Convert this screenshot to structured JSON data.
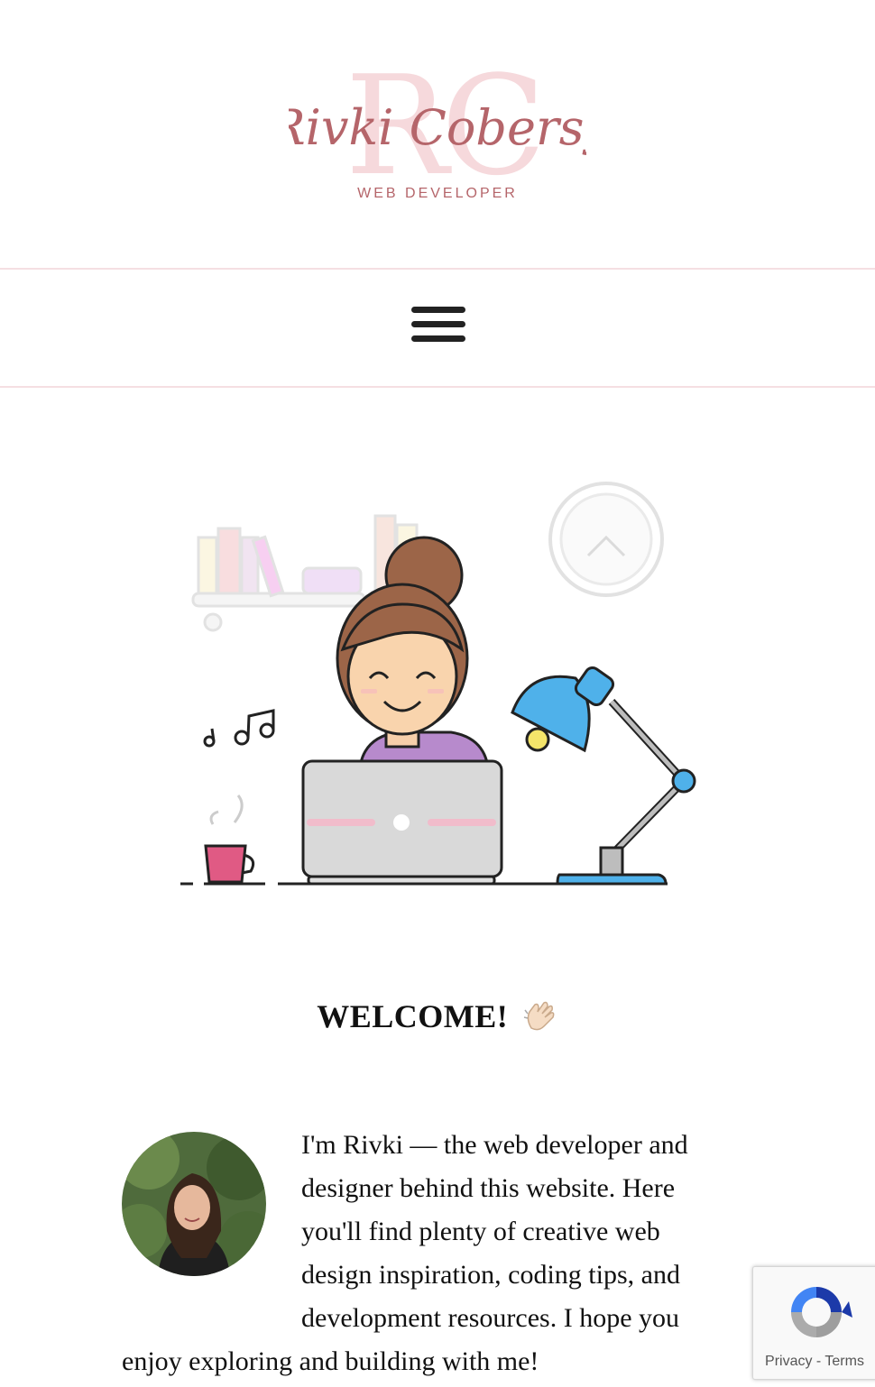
{
  "header": {
    "logo_script": "Rivki Cobersy",
    "logo_monogram": "RC",
    "logo_subtitle": "WEB DEVELOPER"
  },
  "nav": {
    "menu_icon": "hamburger-menu-icon"
  },
  "hero": {
    "illustration": "developer-at-desk-illustration"
  },
  "welcome": {
    "heading": "WELCOME!",
    "emoji": "waving-hand-icon"
  },
  "intro": {
    "text": "I'm Rivki — the web developer and designer behind this website. Here you'll find plenty of creative web design inspiration, coding tips, and development resources. I hope you enjoy exploring and building with me!"
  },
  "recaptcha": {
    "privacy": "Privacy",
    "separator": " - ",
    "terms": "Terms"
  },
  "colors": {
    "brand": "#b5656a",
    "monogram": "#f6d9dc",
    "divider": "#f5dfe2"
  }
}
